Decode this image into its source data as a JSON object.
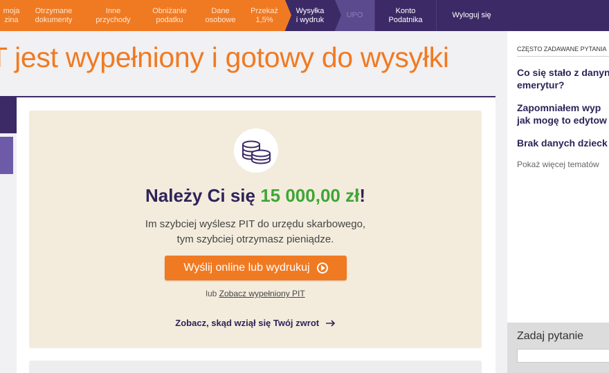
{
  "nav": {
    "tabs": [
      {
        "label_line1": "moja",
        "label_line2": "zina"
      },
      {
        "label_line1": "Otrzymane",
        "label_line2": "dokumenty"
      },
      {
        "label_line1": "Inne",
        "label_line2": "przychody"
      },
      {
        "label_line1": "Obniżanie",
        "label_line2": "podatku"
      },
      {
        "label_line1": "Dane",
        "label_line2": "osobowe"
      },
      {
        "label_line1": "Przekaż",
        "label_line2": "1,5%"
      },
      {
        "label_line1": "Wysyłka",
        "label_line2": "i wydruk"
      },
      {
        "label_line1": "UPO",
        "label_line2": ""
      },
      {
        "label_line1": "Konto",
        "label_line2": "Podatnika"
      },
      {
        "label_line1": "Wyloguj się",
        "label_line2": ""
      }
    ]
  },
  "page": {
    "heading": "T jest wypełniony i gotowy do wysyłki"
  },
  "refund": {
    "due_prefix": "Należy Ci się ",
    "amount": "15 000,00 zł",
    "due_suffix": "!",
    "subtext_line1": "Im szybciej wyślesz PIT do urzędu skarbowego,",
    "subtext_line2": "tym szybciej otrzymasz pieniądze.",
    "send_button": "Wyślij online lub wydrukuj",
    "or_prefix": "lub ",
    "view_link": "Zobacz wypełniony PIT",
    "see_link": "Zobacz, skąd wziął się Twój zwrot"
  },
  "faq": {
    "header": "CZĘSTO ZADAWANE PYTANIA",
    "q1_line1": "Co się stało z danyn",
    "q1_line2": "emerytur?",
    "q2_line1": "Zapomniałem wyp",
    "q2_line2": "jak mogę to edytow",
    "q3": "Brak danych dzieck",
    "more": "Pokaż więcej tematów"
  },
  "ask": {
    "title": "Zadaj pytanie"
  },
  "colors": {
    "orange": "#f07a22",
    "purple": "#3b2a66",
    "green": "#3fa535"
  }
}
